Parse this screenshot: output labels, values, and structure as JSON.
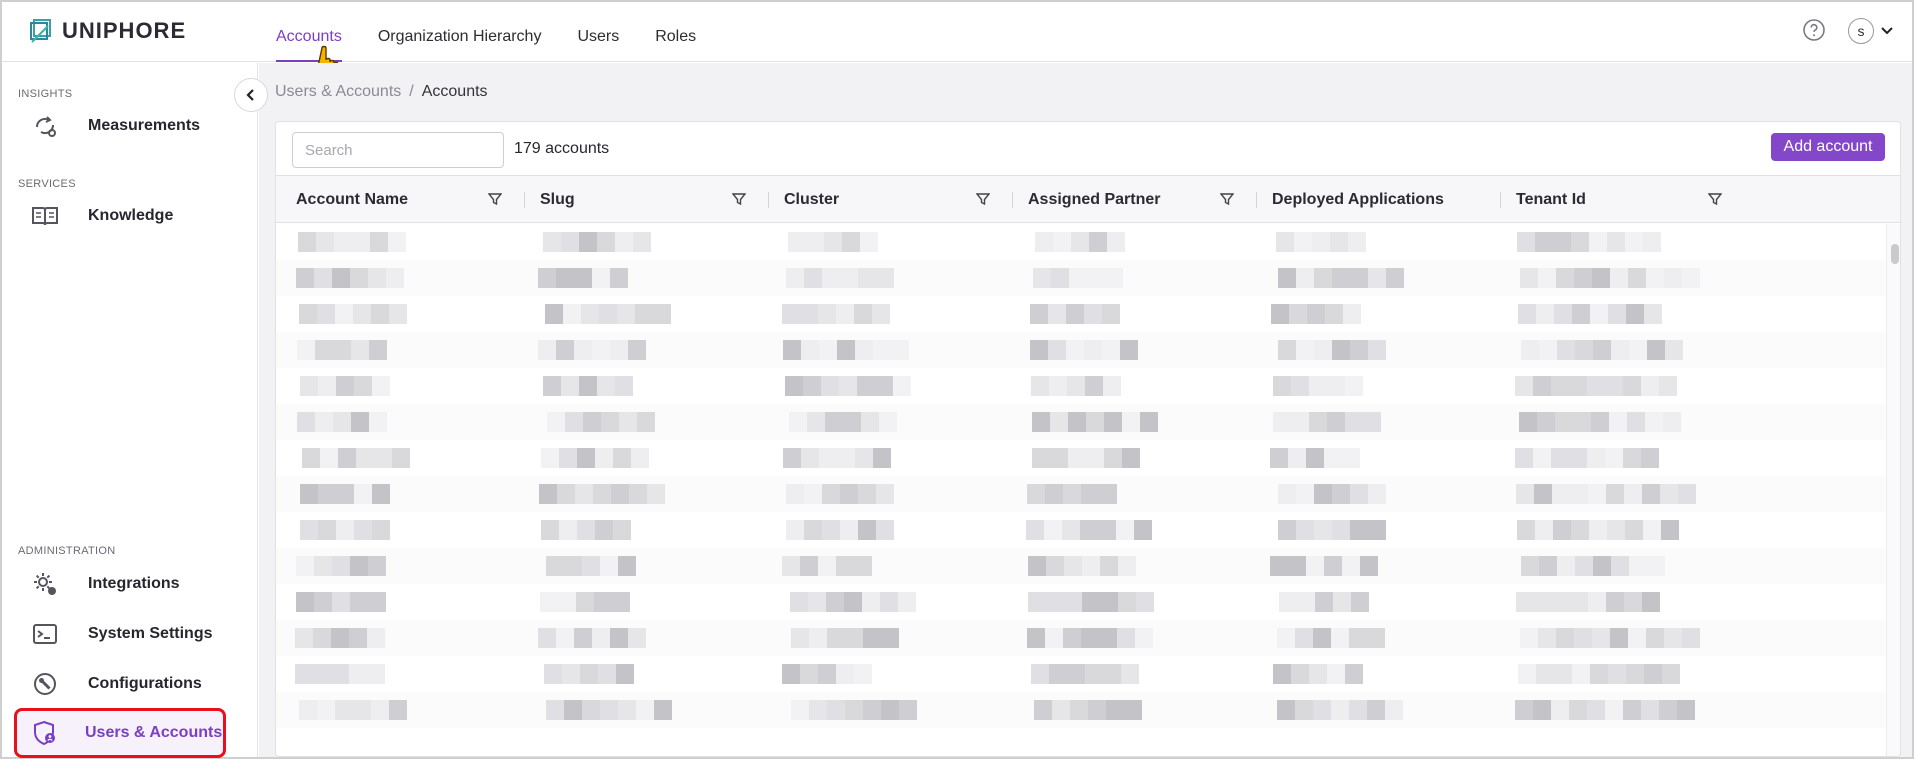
{
  "brand": {
    "name": "UNIPHORE"
  },
  "nav": {
    "tabs": [
      {
        "label": "Accounts",
        "active": true
      },
      {
        "label": "Organization Hierarchy",
        "active": false
      },
      {
        "label": "Users",
        "active": false
      },
      {
        "label": "Roles",
        "active": false
      }
    ],
    "user_initial": "s"
  },
  "sidebar": {
    "sections": [
      {
        "label": "INSIGHTS",
        "items": [
          {
            "label": "Measurements",
            "icon": "measurements-icon"
          }
        ]
      },
      {
        "label": "SERVICES",
        "items": [
          {
            "label": "Knowledge",
            "icon": "book-icon"
          }
        ]
      },
      {
        "label": "ADMINISTRATION",
        "items": [
          {
            "label": "Integrations",
            "icon": "gear-icon"
          },
          {
            "label": "System Settings",
            "icon": "terminal-icon"
          },
          {
            "label": "Configurations",
            "icon": "wrench-icon"
          },
          {
            "label": "Users & Accounts",
            "icon": "shield-user-icon",
            "active": true
          }
        ]
      }
    ]
  },
  "breadcrumb": {
    "parent": "Users & Accounts",
    "separator": "/",
    "current": "Accounts"
  },
  "toolbar": {
    "search_placeholder": "Search",
    "count_text": "179 accounts",
    "add_label": "Add account"
  },
  "table": {
    "columns": [
      {
        "label": "Account Name",
        "filter": true
      },
      {
        "label": "Slug",
        "filter": true
      },
      {
        "label": "Cluster",
        "filter": true
      },
      {
        "label": "Assigned Partner",
        "filter": true
      },
      {
        "label": "Deployed Applications",
        "filter": false
      },
      {
        "label": "Tenant Id",
        "filter": true
      }
    ],
    "rows_note_redacted": true,
    "visible_row_count": 14
  },
  "colors": {
    "accent": "#7b3fc4",
    "button": "#8447c9",
    "highlight_border": "#e8101c"
  }
}
